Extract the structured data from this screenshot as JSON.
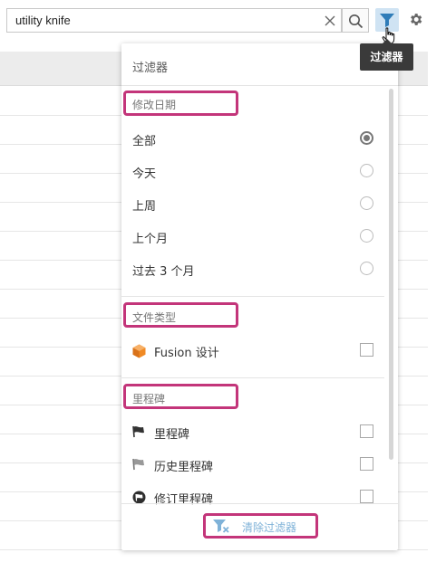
{
  "search": {
    "value": "utility knife"
  },
  "tooltip": {
    "text": "过滤器"
  },
  "filter_panel": {
    "title": "过滤器",
    "sections": [
      {
        "title": "修改日期",
        "type": "radio",
        "options": [
          {
            "label": "全部",
            "checked": true
          },
          {
            "label": "今天",
            "checked": false
          },
          {
            "label": "上周",
            "checked": false
          },
          {
            "label": "上个月",
            "checked": false
          },
          {
            "label": "过去 3 个月",
            "checked": false
          }
        ]
      },
      {
        "title": "文件类型",
        "type": "checkbox",
        "options": [
          {
            "label": "Fusion 设计",
            "icon": "fusion-design-icon",
            "checked": false
          }
        ]
      },
      {
        "title": "里程碑",
        "type": "checkbox",
        "options": [
          {
            "label": "里程碑",
            "icon": "milestone-flag-icon",
            "checked": false
          },
          {
            "label": "历史里程碑",
            "icon": "historical-milestone-flag-icon",
            "checked": false
          },
          {
            "label": "修订里程碑",
            "icon": "revision-milestone-icon",
            "checked": false
          }
        ]
      }
    ],
    "clear_filters_label": "清除过滤器"
  },
  "colors": {
    "highlight": "#c3357a",
    "filter_active_bg": "#cfe3f3",
    "filter_icon": "#2f7cb8",
    "link": "#7fb2d8",
    "fusion_orange": "#f08a24"
  }
}
